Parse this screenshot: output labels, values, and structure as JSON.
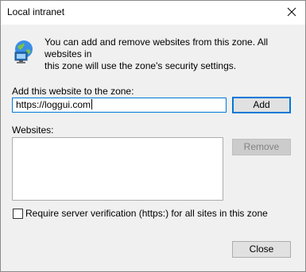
{
  "window": {
    "title": "Local intranet"
  },
  "info": {
    "icon": "globe-computer-icon",
    "line1": "You can add and remove websites from this zone. All websites in",
    "line2": "this zone will use the zone's security settings."
  },
  "add_section": {
    "label": "Add this website to the zone:",
    "value": "https://loggui.com",
    "add_button": "Add"
  },
  "websites_section": {
    "label": "Websites:",
    "items": [],
    "remove_button": "Remove"
  },
  "options": {
    "require_https_label": "Require server verification (https:) for all sites in this zone",
    "require_https_checked": false
  },
  "footer": {
    "close_button": "Close"
  },
  "colors": {
    "focus": "#0078d7",
    "body_bg": "#f0f0f0"
  }
}
